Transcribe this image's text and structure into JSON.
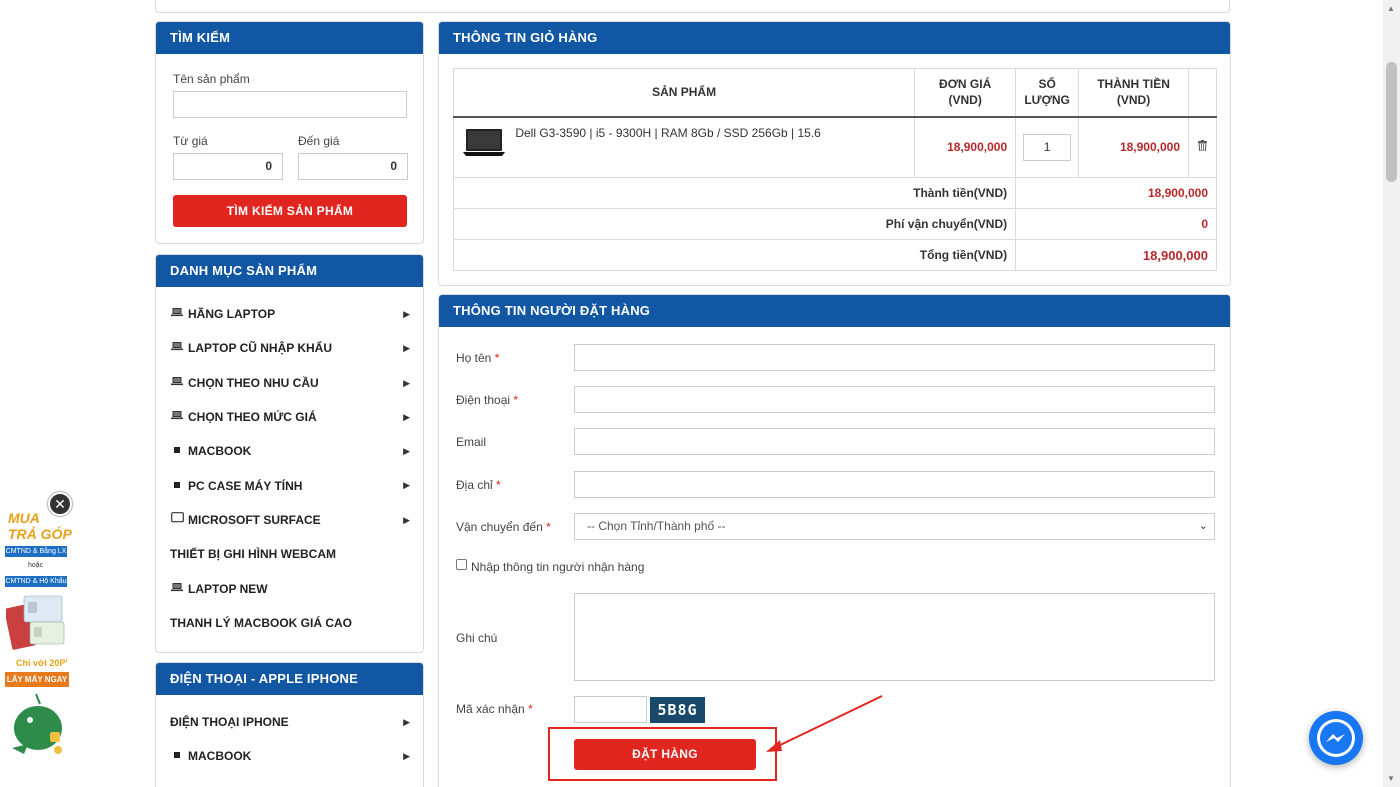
{
  "search": {
    "title": "TÌM KIẾM",
    "name_label": "Tên sản phẩm",
    "from_label": "Từ giá",
    "to_label": "Đến giá",
    "from_value": "0",
    "to_value": "0",
    "button": "TÌM KIẾM SẢN PHẨM"
  },
  "categories": {
    "title": "DANH MỤC SẢN PHẨM",
    "items": [
      {
        "label": "HÃNG LAPTOP",
        "icon": "laptop-icon",
        "arrow": true
      },
      {
        "label": "LAPTOP CŨ NHẬP KHẨU",
        "icon": "laptop-icon",
        "arrow": true
      },
      {
        "label": "CHỌN THEO NHU CẦU",
        "icon": "laptop-icon",
        "arrow": true
      },
      {
        "label": "CHỌN THEO MỨC GIÁ",
        "icon": "laptop-icon",
        "arrow": true
      },
      {
        "label": "MACBOOK",
        "icon": "square-icon",
        "arrow": true
      },
      {
        "label": "PC CASE MÁY TÍNH",
        "icon": "square-icon",
        "arrow": true
      },
      {
        "label": "MICROSOFT SURFACE",
        "icon": "tablet-icon",
        "arrow": true
      },
      {
        "label": "THIẾT BỊ GHI HÌNH WEBCAM",
        "icon": "",
        "arrow": false
      },
      {
        "label": "LAPTOP NEW",
        "icon": "laptop-icon",
        "arrow": false
      },
      {
        "label": "THANH LÝ MACBOOK GIÁ CAO",
        "icon": "",
        "arrow": false
      }
    ]
  },
  "phones": {
    "title": "ĐIỆN THOẠI - APPLE IPHONE",
    "items": [
      {
        "label": "ĐIỆN THOẠI IPHONE",
        "icon": "",
        "arrow": true
      },
      {
        "label": "MACBOOK",
        "icon": "square-icon",
        "arrow": true
      }
    ]
  },
  "cart": {
    "title": "THÔNG TIN GIỎ HÀNG",
    "headers": {
      "product": "SẢN PHẨM",
      "unit_price_1": "ĐƠN GIÁ",
      "unit_price_2": "(VND)",
      "qty_1": "SỐ",
      "qty_2": "LƯỢNG",
      "total_1": "THÀNH TIỀN",
      "total_2": "(VND)"
    },
    "item": {
      "name": "Dell G3-3590 | i5 - 9300H | RAM 8Gb / SSD 256Gb | 15.6",
      "unit_price": "18,900,000",
      "qty": "1",
      "total": "18,900,000"
    },
    "subtotal_label": "Thành tiền(VND)",
    "subtotal": "18,900,000",
    "shipping_label": "Phí vận chuyển(VND)",
    "shipping": "0",
    "grand_label": "Tổng tiền(VND)",
    "grand": "18,900,000"
  },
  "order": {
    "title": "THÔNG TIN NGƯỜI ĐẶT HÀNG",
    "name_label": "Họ tên",
    "phone_label": "Điện thoại",
    "email_label": "Email",
    "address_label": "Địa chỉ",
    "ship_label": "Vận chuyển đến",
    "ship_placeholder": "-- Chọn Tỉnh/Thành phố --",
    "receiver_checkbox": "Nhập thông tin người nhận hàng",
    "note_label": "Ghi chú",
    "captcha_label": "Mã xác nhận",
    "captcha_code": "5B8G",
    "submit": "ĐẶT HÀNG",
    "required_mark": "*"
  },
  "promo": {
    "line1": "MUA",
    "line2": "TRẢ GÓP",
    "tag1": "CMTND & Bằng LX",
    "or": "hoặc",
    "tag2": "CMTND & Hộ Khẩu",
    "line3": "Chỉ với 20P'",
    "line4": "LẤY MÁY NGAY"
  },
  "colors": {
    "header_blue": "#1257a4",
    "accent_red": "#e0261e",
    "price_red": "#b8282b"
  }
}
